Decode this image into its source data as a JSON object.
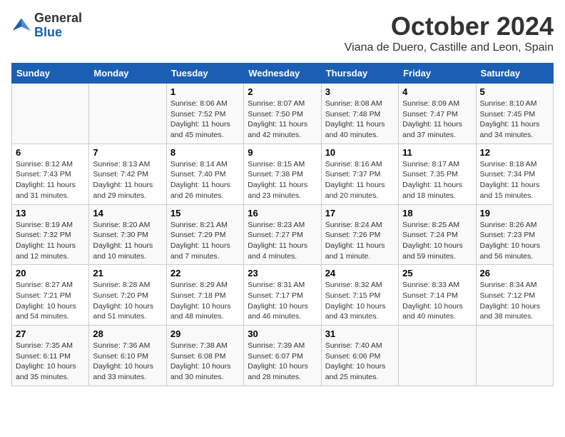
{
  "logo": {
    "line1": "General",
    "line2": "Blue"
  },
  "title": "October 2024",
  "subtitle": "Viana de Duero, Castille and Leon, Spain",
  "days_of_week": [
    "Sunday",
    "Monday",
    "Tuesday",
    "Wednesday",
    "Thursday",
    "Friday",
    "Saturday"
  ],
  "weeks": [
    [
      {
        "day": "",
        "info": ""
      },
      {
        "day": "",
        "info": ""
      },
      {
        "day": "1",
        "info": "Sunrise: 8:06 AM\nSunset: 7:52 PM\nDaylight: 11 hours and 45 minutes."
      },
      {
        "day": "2",
        "info": "Sunrise: 8:07 AM\nSunset: 7:50 PM\nDaylight: 11 hours and 42 minutes."
      },
      {
        "day": "3",
        "info": "Sunrise: 8:08 AM\nSunset: 7:48 PM\nDaylight: 11 hours and 40 minutes."
      },
      {
        "day": "4",
        "info": "Sunrise: 8:09 AM\nSunset: 7:47 PM\nDaylight: 11 hours and 37 minutes."
      },
      {
        "day": "5",
        "info": "Sunrise: 8:10 AM\nSunset: 7:45 PM\nDaylight: 11 hours and 34 minutes."
      }
    ],
    [
      {
        "day": "6",
        "info": "Sunrise: 8:12 AM\nSunset: 7:43 PM\nDaylight: 11 hours and 31 minutes."
      },
      {
        "day": "7",
        "info": "Sunrise: 8:13 AM\nSunset: 7:42 PM\nDaylight: 11 hours and 29 minutes."
      },
      {
        "day": "8",
        "info": "Sunrise: 8:14 AM\nSunset: 7:40 PM\nDaylight: 11 hours and 26 minutes."
      },
      {
        "day": "9",
        "info": "Sunrise: 8:15 AM\nSunset: 7:38 PM\nDaylight: 11 hours and 23 minutes."
      },
      {
        "day": "10",
        "info": "Sunrise: 8:16 AM\nSunset: 7:37 PM\nDaylight: 11 hours and 20 minutes."
      },
      {
        "day": "11",
        "info": "Sunrise: 8:17 AM\nSunset: 7:35 PM\nDaylight: 11 hours and 18 minutes."
      },
      {
        "day": "12",
        "info": "Sunrise: 8:18 AM\nSunset: 7:34 PM\nDaylight: 11 hours and 15 minutes."
      }
    ],
    [
      {
        "day": "13",
        "info": "Sunrise: 8:19 AM\nSunset: 7:32 PM\nDaylight: 11 hours and 12 minutes."
      },
      {
        "day": "14",
        "info": "Sunrise: 8:20 AM\nSunset: 7:30 PM\nDaylight: 11 hours and 10 minutes."
      },
      {
        "day": "15",
        "info": "Sunrise: 8:21 AM\nSunset: 7:29 PM\nDaylight: 11 hours and 7 minutes."
      },
      {
        "day": "16",
        "info": "Sunrise: 8:23 AM\nSunset: 7:27 PM\nDaylight: 11 hours and 4 minutes."
      },
      {
        "day": "17",
        "info": "Sunrise: 8:24 AM\nSunset: 7:26 PM\nDaylight: 11 hours and 1 minute."
      },
      {
        "day": "18",
        "info": "Sunrise: 8:25 AM\nSunset: 7:24 PM\nDaylight: 10 hours and 59 minutes."
      },
      {
        "day": "19",
        "info": "Sunrise: 8:26 AM\nSunset: 7:23 PM\nDaylight: 10 hours and 56 minutes."
      }
    ],
    [
      {
        "day": "20",
        "info": "Sunrise: 8:27 AM\nSunset: 7:21 PM\nDaylight: 10 hours and 54 minutes."
      },
      {
        "day": "21",
        "info": "Sunrise: 8:28 AM\nSunset: 7:20 PM\nDaylight: 10 hours and 51 minutes."
      },
      {
        "day": "22",
        "info": "Sunrise: 8:29 AM\nSunset: 7:18 PM\nDaylight: 10 hours and 48 minutes."
      },
      {
        "day": "23",
        "info": "Sunrise: 8:31 AM\nSunset: 7:17 PM\nDaylight: 10 hours and 46 minutes."
      },
      {
        "day": "24",
        "info": "Sunrise: 8:32 AM\nSunset: 7:15 PM\nDaylight: 10 hours and 43 minutes."
      },
      {
        "day": "25",
        "info": "Sunrise: 8:33 AM\nSunset: 7:14 PM\nDaylight: 10 hours and 40 minutes."
      },
      {
        "day": "26",
        "info": "Sunrise: 8:34 AM\nSunset: 7:12 PM\nDaylight: 10 hours and 38 minutes."
      }
    ],
    [
      {
        "day": "27",
        "info": "Sunrise: 7:35 AM\nSunset: 6:11 PM\nDaylight: 10 hours and 35 minutes."
      },
      {
        "day": "28",
        "info": "Sunrise: 7:36 AM\nSunset: 6:10 PM\nDaylight: 10 hours and 33 minutes."
      },
      {
        "day": "29",
        "info": "Sunrise: 7:38 AM\nSunset: 6:08 PM\nDaylight: 10 hours and 30 minutes."
      },
      {
        "day": "30",
        "info": "Sunrise: 7:39 AM\nSunset: 6:07 PM\nDaylight: 10 hours and 28 minutes."
      },
      {
        "day": "31",
        "info": "Sunrise: 7:40 AM\nSunset: 6:06 PM\nDaylight: 10 hours and 25 minutes."
      },
      {
        "day": "",
        "info": ""
      },
      {
        "day": "",
        "info": ""
      }
    ]
  ]
}
